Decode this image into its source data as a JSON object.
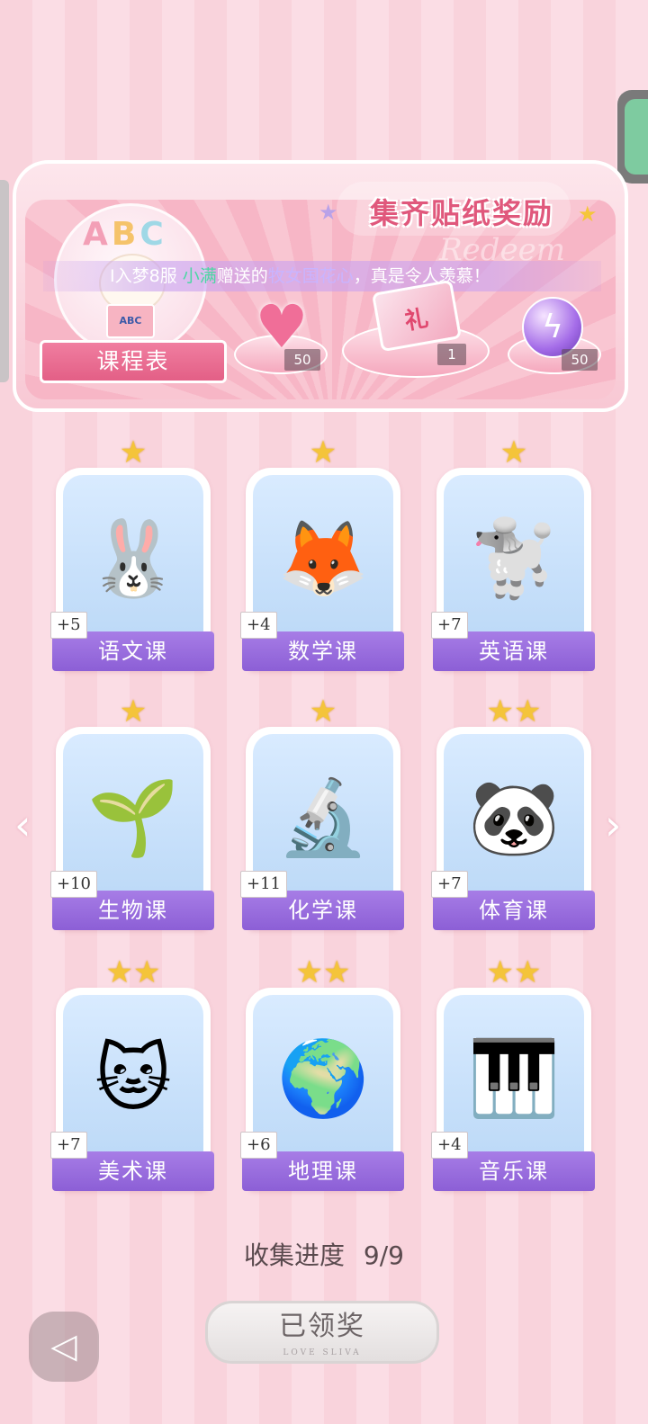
{
  "banner": {
    "title": "集齐贴纸奖励",
    "watermark": "Redeem",
    "marquee_prefix": "I入梦8服 ",
    "marquee_name": "小满",
    "marquee_mid": "赠送的",
    "marquee_gift": "牧女国花心",
    "marquee_suffix": "，真是令人羡慕！",
    "mascot_letters": [
      "A",
      "B",
      "C"
    ],
    "mascot_book": "ABC",
    "schedule_label": "课程表",
    "rewards": [
      {
        "icon": "pink-heart-gem-icon",
        "quantity": "50"
      },
      {
        "icon": "gift-box-icon",
        "quantity": "1"
      },
      {
        "icon": "purple-lightning-orb-icon",
        "quantity": "50"
      }
    ]
  },
  "courses": [
    {
      "label": "语文课",
      "bonus": "+5",
      "stars": "★",
      "icon": "rabbit-calligraphy-icon",
      "emoji": "🐰"
    },
    {
      "label": "数学课",
      "bonus": "+4",
      "stars": "★",
      "icon": "fox-teacher-icon",
      "emoji": "🦊"
    },
    {
      "label": "英语课",
      "bonus": "+7",
      "stars": "★",
      "icon": "poodle-book-icon",
      "emoji": "🐩"
    },
    {
      "label": "生物课",
      "bonus": "+10",
      "stars": "★",
      "icon": "sprout-sun-icon",
      "emoji": "🌱"
    },
    {
      "label": "化学课",
      "bonus": "+11",
      "stars": "★",
      "icon": "microscope-icon",
      "emoji": "🔬"
    },
    {
      "label": "体育课",
      "bonus": "+7",
      "stars": "★★",
      "icon": "panda-pingpong-icon",
      "emoji": "🐼"
    },
    {
      "label": "美术课",
      "bonus": "+7",
      "stars": "★★",
      "icon": "cat-painter-icon",
      "emoji": "🐱"
    },
    {
      "label": "地理课",
      "bonus": "+6",
      "stars": "★★",
      "icon": "globe-icon",
      "emoji": "🌍"
    },
    {
      "label": "音乐课",
      "bonus": "+4",
      "stars": "★★",
      "icon": "cat-keyboard-icon",
      "emoji": "🎹"
    }
  ],
  "progress": {
    "label": "收集进度",
    "value": "9/9"
  },
  "claim": {
    "label": "已领奖",
    "sub": "LOVE SLIVA"
  },
  "nav": {
    "prev": "‹",
    "next": "›",
    "back": "◁"
  },
  "colors": {
    "accent": "#e0587c",
    "label_purple": "#8c5fd6",
    "star": "#f4c43a"
  }
}
